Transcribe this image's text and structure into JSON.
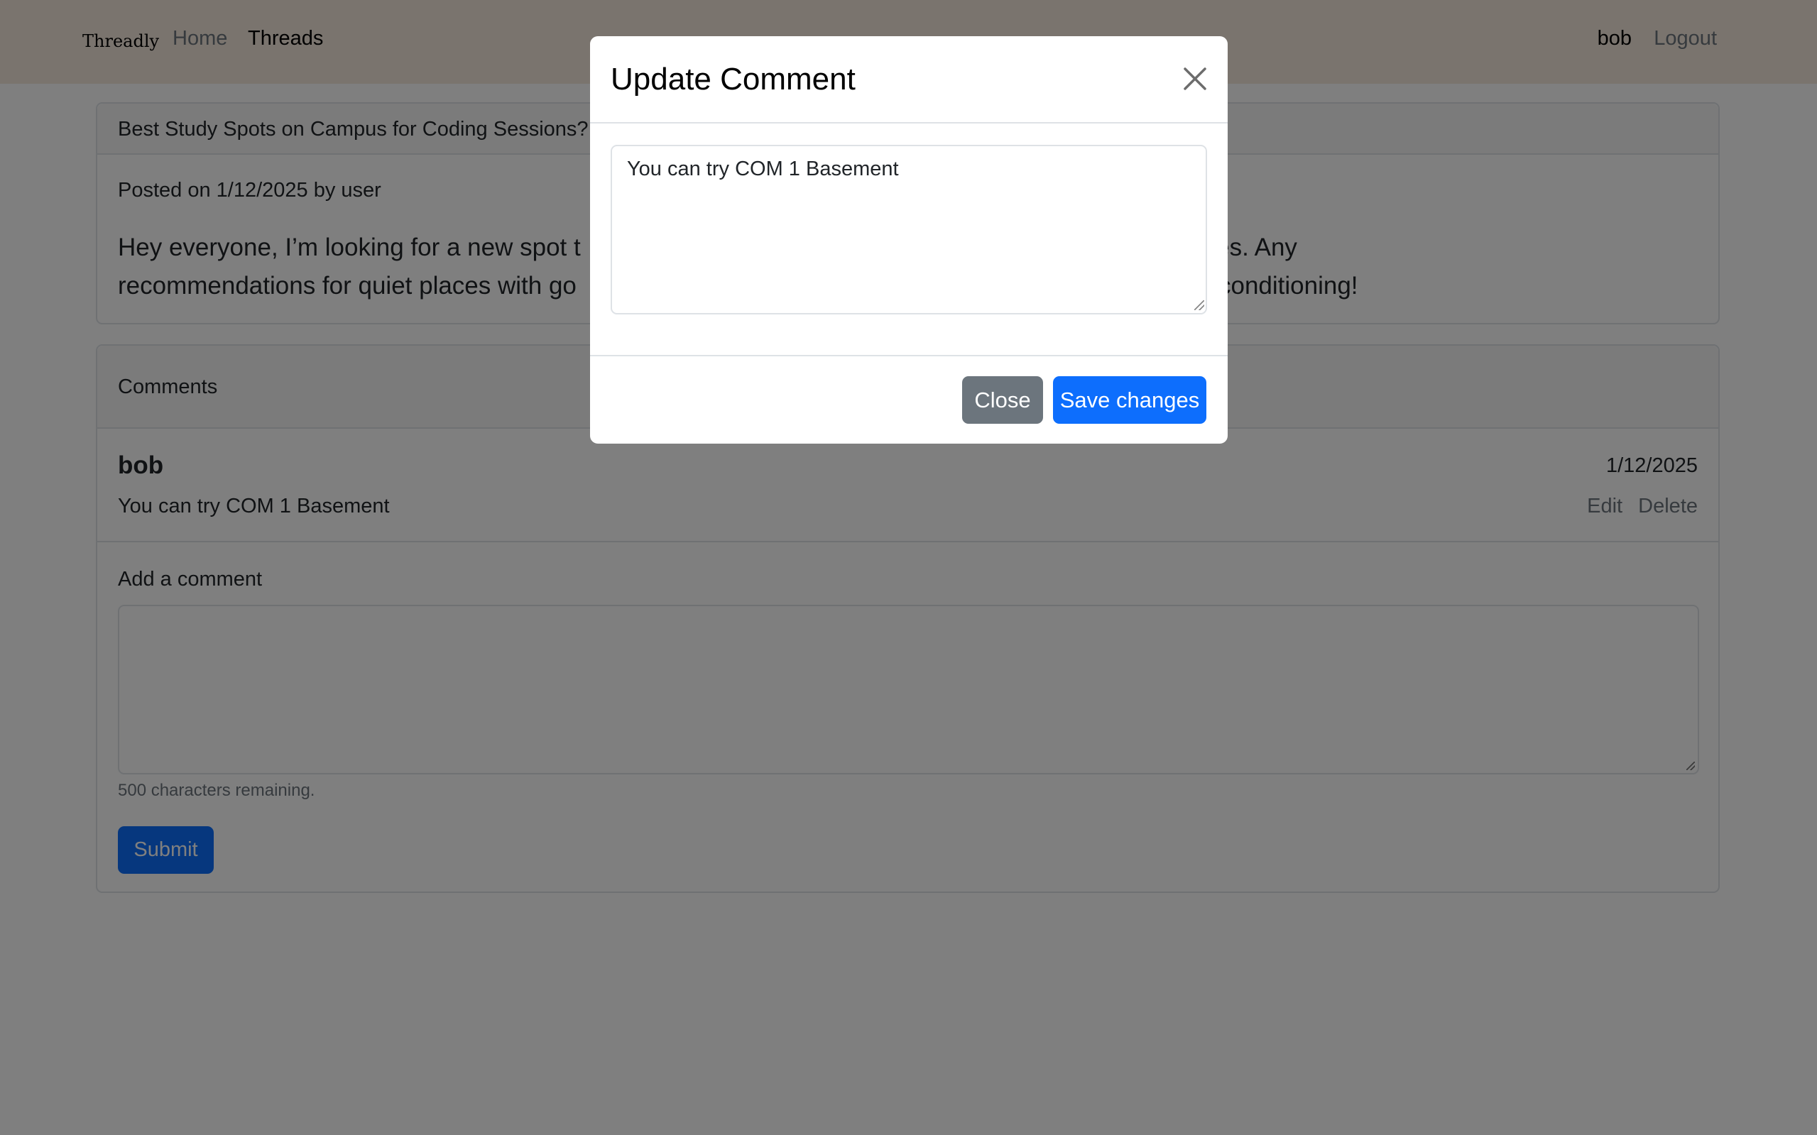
{
  "navbar": {
    "brand": "Threadly",
    "links": [
      "Home",
      "Threads"
    ],
    "user": "bob",
    "logout": "Logout"
  },
  "thread": {
    "title": "Best Study Spots on Campus for Coding Sessions?",
    "meta": "Posted on 1/12/2025 by user",
    "body_visible_left": "Hey everyone, I’m looking for a new spot t",
    "body_visible_right": "gets crowded sometimes. Any",
    "body_line2_left": "recommendations for quiet places with go",
    "body_line2_right": "conditioning!"
  },
  "comments": {
    "header": "Comments",
    "items": [
      {
        "author": "bob",
        "date": "1/12/2025",
        "text": "You can try COM 1 Basement",
        "edit": "Edit",
        "delete": "Delete"
      }
    ],
    "add_label": "Add a comment",
    "chars_remaining": "500 characters remaining.",
    "submit": "Submit"
  },
  "modal": {
    "title": "Update Comment",
    "textarea_value": "You can try COM 1 Basement",
    "close_button": "Close",
    "save_button": "Save changes",
    "close_icon": "close-icon"
  },
  "colors": {
    "navbar_bg": "#f5e9dc",
    "primary": "#0d6efd",
    "secondary": "#6c757d",
    "backdrop": "rgba(0,0,0,0.5)"
  }
}
